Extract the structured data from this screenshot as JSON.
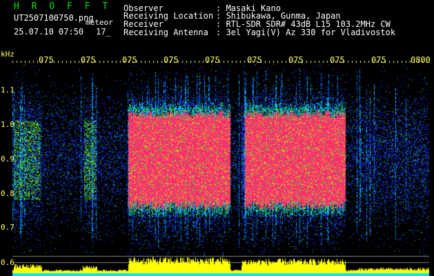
{
  "header": {
    "brand": "H R O F F T",
    "filename": "UT2507100750.png",
    "type_label": "meteor",
    "date_time": "25.07.10 07:50",
    "count": "17_",
    "info": [
      {
        "label": "Observer",
        "value": "Masaki Kano"
      },
      {
        "label": "Receiving Location",
        "value": "Shibukawa, Gunma, Japan"
      },
      {
        "label": "Receiver",
        "value": "RTL-SDR SDR# 43dB L15 103.2MHz CW"
      },
      {
        "label": "Receiving Antenna",
        "value": "3el Yagi(V) Az 330 for Vladivostok"
      }
    ]
  },
  "axis": {
    "unit": "kHz",
    "time_labels": [
      "075",
      "075",
      "075",
      "075",
      "075",
      "075",
      "075",
      "075",
      "075",
      "0800"
    ],
    "freq_labels": [
      "1.1",
      "1.0",
      "0.9",
      "0.8",
      "0.7",
      "0.6"
    ]
  },
  "colors": {
    "background": "#000000",
    "text": "#ffffff",
    "axis_text": "#ffff66",
    "brand": "#00e600",
    "echo_strong": "#ff2a70",
    "echo_mid": "#33dd33",
    "noise": "#1a2fff",
    "level_bar": "#ffff00",
    "level_base": "#00e5ff"
  }
}
